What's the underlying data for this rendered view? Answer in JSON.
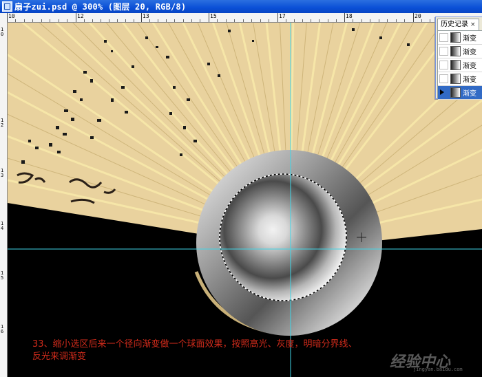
{
  "window": {
    "title": "扇子zui.psd @ 300% (图层 20, RGB/8)"
  },
  "ruler_top": {
    "labels": [
      "10",
      "12",
      "13",
      "15",
      "17",
      "18",
      "20"
    ]
  },
  "ruler_left": {
    "labels": [
      "1",
      "0",
      "1",
      "2",
      "1",
      "3",
      "1",
      "4",
      "1",
      "5",
      "1",
      "6"
    ]
  },
  "history_panel": {
    "title": "历史记录",
    "close": "×",
    "items": [
      {
        "label": "渐变",
        "selected": false
      },
      {
        "label": "渐变",
        "selected": false
      },
      {
        "label": "渐变",
        "selected": false
      },
      {
        "label": "渐变",
        "selected": false
      },
      {
        "label": "渐变",
        "selected": true
      }
    ]
  },
  "caption": {
    "line1": "33、缩小选区后来一个径向渐变做一个球面效果，按照高光、灰度，明暗分界线、",
    "line2": "反光来调渐变"
  },
  "watermark": {
    "text": "经验中心",
    "sub": "jingyan.baidu.com"
  },
  "colors": {
    "fan_paper": "#e9d29e",
    "fan_rib": "#f3df9a",
    "guide": "#3fd6e8",
    "caption": "#d12b1b",
    "selection": "#316ac5"
  }
}
